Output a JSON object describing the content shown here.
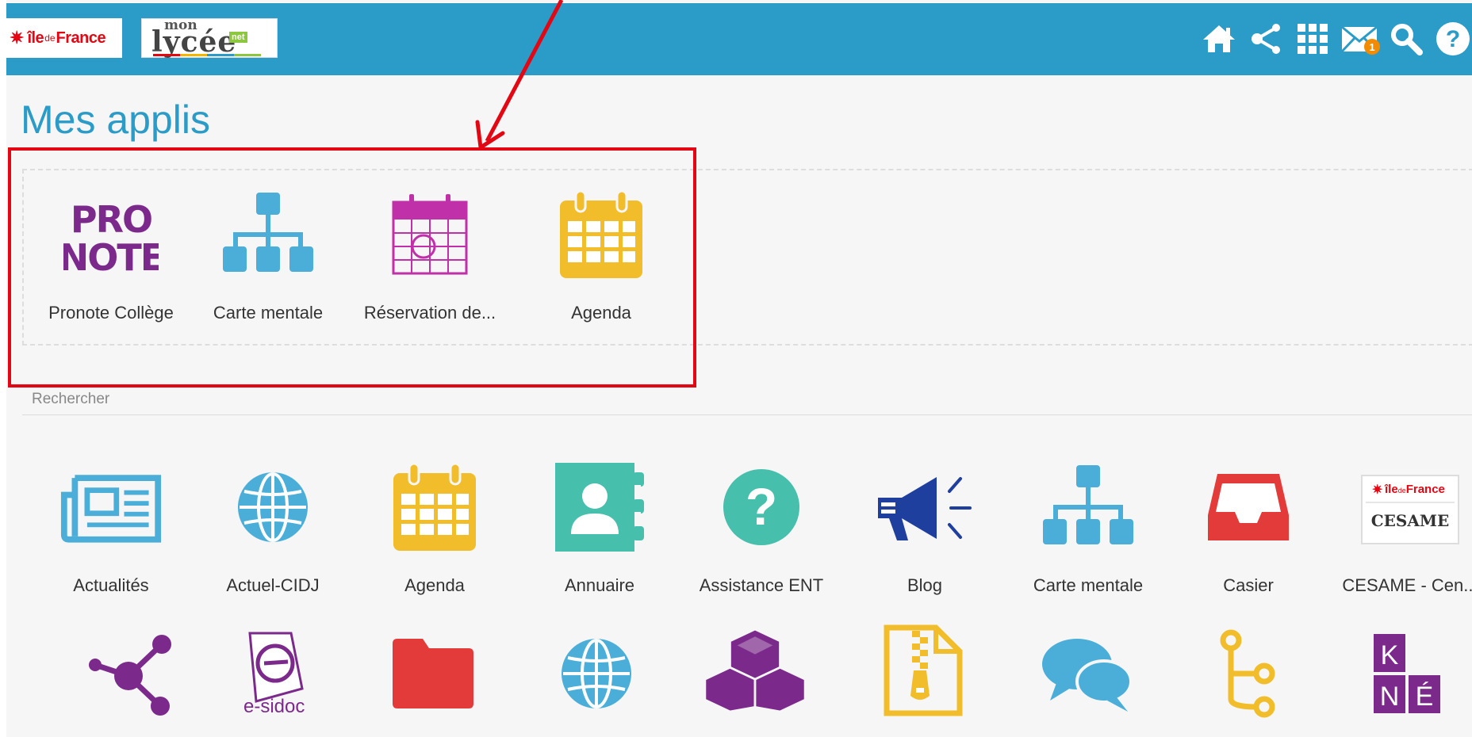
{
  "header": {
    "logo_idf": {
      "ile": "île",
      "de": "de",
      "france": "France"
    },
    "logo_lycee": {
      "mon": "mon",
      "lycee": "lycée",
      "net": "net"
    },
    "nav": [
      {
        "name": "home-icon"
      },
      {
        "name": "share-icon"
      },
      {
        "name": "apps-grid-icon"
      },
      {
        "name": "mail-icon",
        "badge": "1"
      },
      {
        "name": "search-icon"
      },
      {
        "name": "help-icon"
      }
    ]
  },
  "page": {
    "title": "Mes applis"
  },
  "favorites": [
    {
      "label": "Pronote Collège",
      "icon": "pronote-icon",
      "color": "#7b2a8c"
    },
    {
      "label": "Carte mentale",
      "icon": "mindmap-icon",
      "color": "#4aaed9"
    },
    {
      "label": "Réservation de...",
      "icon": "calendar-reservation-icon",
      "color": "#c030a8"
    },
    {
      "label": "Agenda",
      "icon": "calendar-icon",
      "color": "#f1bd2a"
    }
  ],
  "search": {
    "placeholder": "Rechercher"
  },
  "apps_row1": [
    {
      "label": "Actualités",
      "icon": "newspaper-icon",
      "color": "#4aaed9"
    },
    {
      "label": "Actuel-CIDJ",
      "icon": "globe-icon",
      "color": "#4aaed9"
    },
    {
      "label": "Agenda",
      "icon": "calendar-icon",
      "color": "#f1bd2a"
    },
    {
      "label": "Annuaire",
      "icon": "address-book-icon",
      "color": "#46bfad"
    },
    {
      "label": "Assistance ENT",
      "icon": "question-icon",
      "color": "#46bfad"
    },
    {
      "label": "Blog",
      "icon": "megaphone-icon",
      "color": "#1f3f9e"
    },
    {
      "label": "Carte mentale",
      "icon": "mindmap-icon",
      "color": "#4aaed9"
    },
    {
      "label": "Casier",
      "icon": "inbox-tray-icon",
      "color": "#e33a3a"
    },
    {
      "label": "CESAME - Cen...",
      "icon": "cesame-logo-icon",
      "color": "#e30613",
      "logo_text": {
        "ile": "île",
        "de": "de",
        "france": "France",
        "cesame": "CESAME"
      }
    }
  ],
  "apps_row2": [
    {
      "icon": "share-nodes-icon",
      "color": "#7b2a8c"
    },
    {
      "icon": "esidoc-icon",
      "color": "#7b2a8c",
      "logo_text": "e-sidoc"
    },
    {
      "icon": "folder-icon",
      "color": "#e33a3a"
    },
    {
      "icon": "globe-icon",
      "color": "#4aaed9"
    },
    {
      "icon": "cubes-icon",
      "color": "#7b2a8c"
    },
    {
      "icon": "zip-file-icon",
      "color": "#f1bd2a"
    },
    {
      "icon": "chat-bubbles-icon",
      "color": "#4aaed9"
    },
    {
      "icon": "branch-icon",
      "color": "#f1bd2a"
    },
    {
      "icon": "kne-icon",
      "color": "#7b2a8c",
      "logo_text": {
        "k": "K",
        "n": "N",
        "e": "É"
      }
    }
  ]
}
